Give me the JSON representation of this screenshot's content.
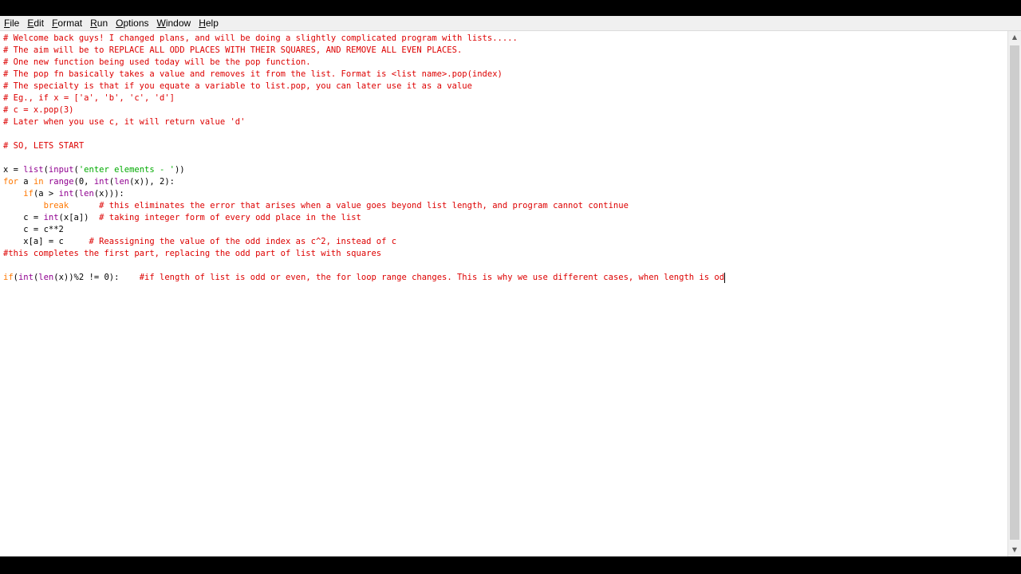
{
  "menu": [
    {
      "accel": "F",
      "rest": "ile"
    },
    {
      "accel": "E",
      "rest": "dit"
    },
    {
      "accel": "F",
      "rest": "ormat",
      "accel_index": 0
    },
    {
      "accel": "R",
      "rest": "un"
    },
    {
      "accel": "O",
      "rest": "ptions"
    },
    {
      "accel": "W",
      "rest": "indow"
    },
    {
      "accel": "H",
      "rest": "elp"
    }
  ],
  "code": {
    "l1": "# Welcome back guys! I changed plans, and will be doing a slightly complicated program with lists.....",
    "l2": "# The aim will be to REPLACE ALL ODD PLACES WITH THEIR SQUARES, AND REMOVE ALL EVEN PLACES.",
    "l3": "# One new function being used today will be the pop function.",
    "l4": "# The pop fn basically takes a value and removes it from the list. Format is <list name>.pop(index)",
    "l5": "# The specialty is that if you equate a variable to list.pop, you can later use it as a value",
    "l6": "# Eg., if x = ['a', 'b', 'c', 'd']",
    "l7": "# c = x.pop(3)",
    "l8": "# Later when you use c, it will return value 'd'",
    "l10": "# SO, LETS START",
    "l12": {
      "a": "x = ",
      "b": "list",
      "c": "(",
      "d": "input",
      "e": "(",
      "f": "'enter elements - '",
      "g": "))"
    },
    "l13": {
      "a": "for",
      "b": " a ",
      "c": "in",
      "d": " ",
      "e": "range",
      "f": "(0, ",
      "g": "int",
      "h": "(",
      "i": "len",
      "j": "(x)), 2):"
    },
    "l14": {
      "a": "    ",
      "b": "if",
      "c": "(a > ",
      "d": "int",
      "e": "(",
      "f": "len",
      "g": "(x))):"
    },
    "l15": {
      "a": "        ",
      "b": "break",
      "c": "      ",
      "d": "# this eliminates the error that arises when a value goes beyond list length, and program cannot continue"
    },
    "l16": {
      "a": "    c = ",
      "b": "int",
      "c": "(x[a])  ",
      "d": "# taking integer form of every odd place in the list"
    },
    "l17": "    c = c**2",
    "l18": {
      "a": "    x[a] = c     ",
      "b": "# Reassigning the value of the odd index as c^2, instead of c"
    },
    "l19": "#this completes the first part, replacing the odd part of list with squares",
    "l21": {
      "a": "if",
      "b": "(",
      "c": "int",
      "d": "(",
      "e": "len",
      "f": "(x))%2 != 0):    ",
      "g": "#if length of list is odd or even, the for loop range changes. This is why we use different cases, when length is od"
    }
  }
}
